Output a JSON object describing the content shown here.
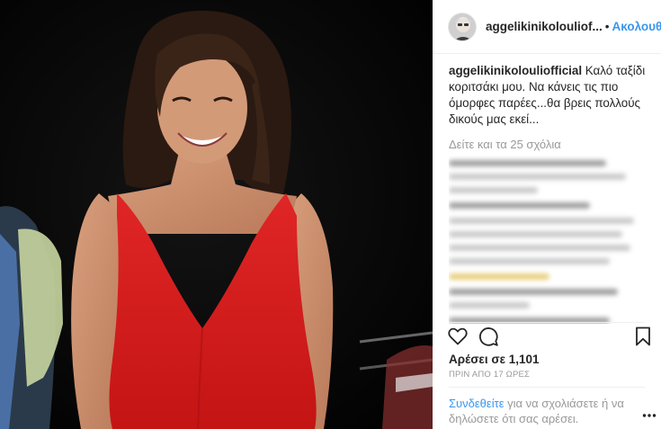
{
  "post": {
    "username": "aggelikinikolouliofficial",
    "username_header": "aggelikinikolouliof...",
    "follow_label": "Ακολουθήστε",
    "dot": "•",
    "caption_user": "aggelikinikolouliofficial",
    "caption_text": " Καλό ταξίδι κοριτσάκι μου. Να κάνεις τις πιο όμορφες παρέες...θα βρεις πολλούς δικούς μας εκεί...",
    "view_all_comments": "Δείτε και τα 25 σχόλια",
    "likes": "Αρέσει σε 1,101",
    "time_ago": "ΠΡΙΝ ΑΠΟ 17 ΩΡΕΣ",
    "login_link": "Συνδεθείτε",
    "login_rest": " για να σχολιάσετε ή να δηλώσετε ότι σας αρέσει."
  },
  "icons": {
    "like": "heart-icon",
    "comment": "comment-icon",
    "save": "bookmark-icon",
    "more": "more-options-icon"
  },
  "colors": {
    "link_blue": "#3897f0",
    "text": "#262626",
    "secondary": "#999999",
    "dress_red": "#d81f1f"
  }
}
